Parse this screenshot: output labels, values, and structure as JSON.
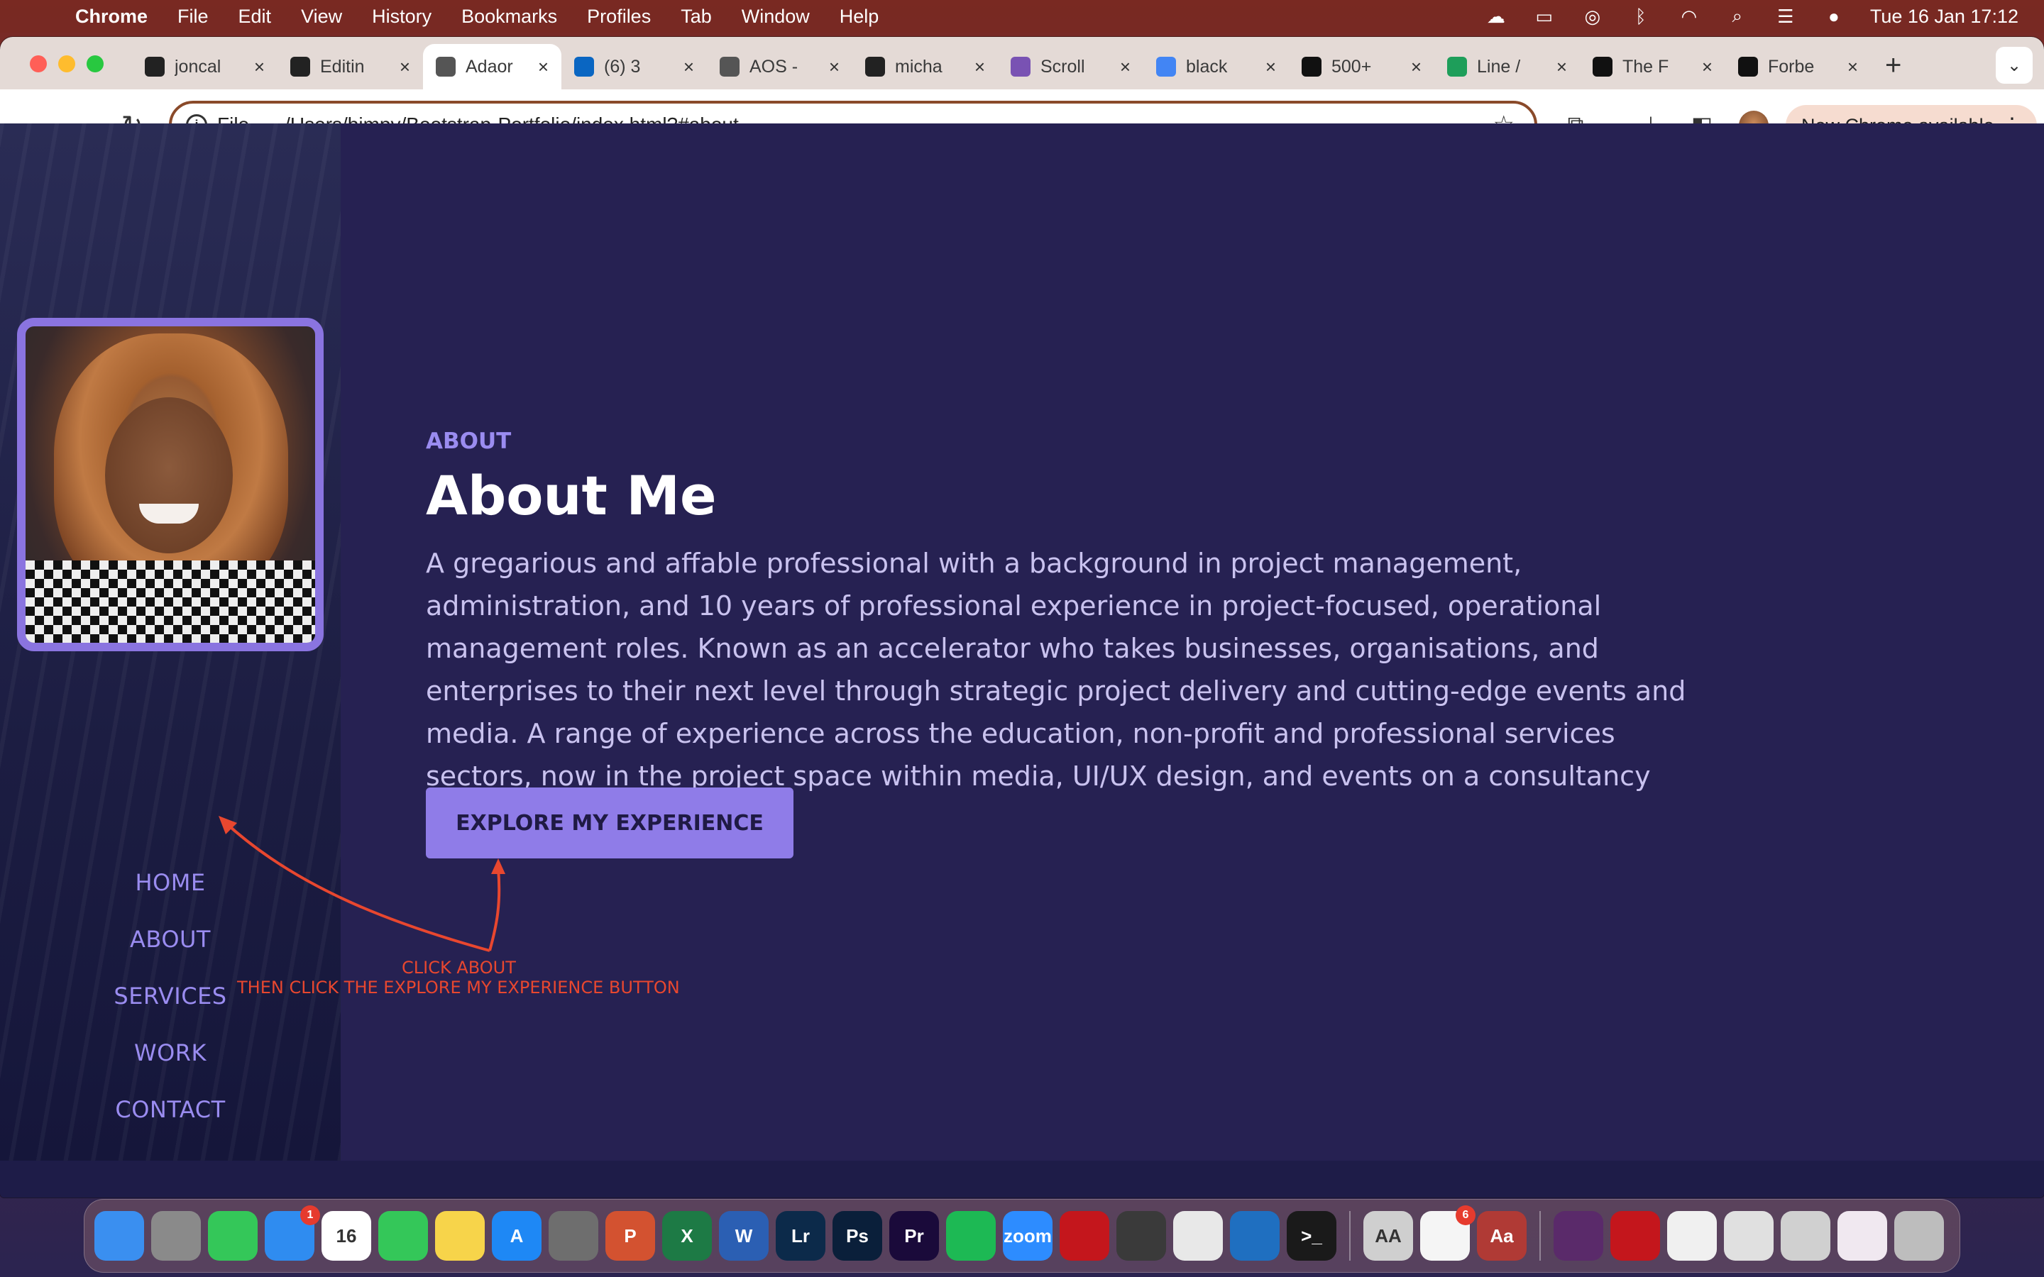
{
  "menubar": {
    "app_name": "Chrome",
    "items": [
      "File",
      "Edit",
      "View",
      "History",
      "Bookmarks",
      "Profiles",
      "Tab",
      "Window",
      "Help"
    ],
    "clock": "Tue 16 Jan  17:12"
  },
  "tabs": [
    {
      "title": "joncal",
      "icon": "github-icon",
      "color": "#222222"
    },
    {
      "title": "Editin",
      "icon": "github-icon",
      "color": "#222222"
    },
    {
      "title": "Adaor",
      "icon": "globe-icon",
      "color": "#555555",
      "active": true
    },
    {
      "title": "(6) 3",
      "icon": "linkedin-icon",
      "color": "#0a66c2"
    },
    {
      "title": "AOS -",
      "icon": "globe-icon",
      "color": "#555555"
    },
    {
      "title": "micha",
      "icon": "github-icon",
      "color": "#222222"
    },
    {
      "title": "Scroll",
      "icon": "bootstrap-icon",
      "color": "#7952b3"
    },
    {
      "title": "black",
      "icon": "google-icon",
      "color": "#4285f4"
    },
    {
      "title": "500+",
      "icon": "unsplash-icon",
      "color": "#111111"
    },
    {
      "title": "Line /",
      "icon": "sheets-icon",
      "color": "#1e9e5a"
    },
    {
      "title": "The F",
      "icon": "medium-icon",
      "color": "#111111"
    },
    {
      "title": "Forbe",
      "icon": "forbes-icon",
      "color": "#111111"
    }
  ],
  "toolbar": {
    "scheme_label": "File",
    "url": "/Users/bimpy/Bootstrap-Portfolio/index.html?#about",
    "update_label": "New Chrome available"
  },
  "nav": {
    "items": [
      "HOME",
      "ABOUT",
      "SERVICES",
      "WORK",
      "CONTACT"
    ]
  },
  "about": {
    "eyebrow": "ABOUT",
    "heading": "About Me",
    "bio": "A gregarious and affable professional with a background in project management, administration, and 10 years of professional experience in project-focused, operational management roles. Known as an accelerator who takes businesses, organisations, and enterprises to their next level through strategic project delivery and cutting-edge events and media. A range of experience across the education, non-profit and professional services sectors, now in the project space within media, UI/UX design, and events on a consultancy basis.",
    "cta_label": "EXPLORE MY EXPERIENCE"
  },
  "annotations": {
    "line1": "CLICK ABOUT",
    "line2": "THEN CLICK THE EXPLORE MY EXPERIENCE BUTTON",
    "color": "#e8472f"
  },
  "dock": {
    "items": [
      {
        "name": "finder-icon",
        "label": "",
        "color": "#3a8ff0"
      },
      {
        "name": "launchpad-icon",
        "label": "",
        "color": "#8a8a8a"
      },
      {
        "name": "messages-icon",
        "label": "",
        "color": "#34c759"
      },
      {
        "name": "mail-icon",
        "label": "",
        "color": "#2f8cf0",
        "badge": "1"
      },
      {
        "name": "calendar-icon",
        "label": "16",
        "color": "#ffffff"
      },
      {
        "name": "facetime-icon",
        "label": "",
        "color": "#34c759"
      },
      {
        "name": "notes-icon",
        "label": "",
        "color": "#f7d44a"
      },
      {
        "name": "app-store-icon",
        "label": "A",
        "color": "#1e88f5"
      },
      {
        "name": "system-settings-icon",
        "label": "",
        "color": "#6e6e6e"
      },
      {
        "name": "powerpoint-icon",
        "label": "P",
        "color": "#d35230"
      },
      {
        "name": "excel-icon",
        "label": "X",
        "color": "#1d7a45"
      },
      {
        "name": "word-icon",
        "label": "W",
        "color": "#2b5fb3"
      },
      {
        "name": "lightroom-icon",
        "label": "Lr",
        "color": "#0c2a4a"
      },
      {
        "name": "photoshop-icon",
        "label": "Ps",
        "color": "#0a1f3a"
      },
      {
        "name": "premiere-icon",
        "label": "Pr",
        "color": "#1a0a3a"
      },
      {
        "name": "spotify-icon",
        "label": "",
        "color": "#1db954"
      },
      {
        "name": "zoom-icon",
        "label": "zoom",
        "color": "#2d8cff"
      },
      {
        "name": "acrobat-icon",
        "label": "",
        "color": "#c4161c"
      },
      {
        "name": "calculator-icon",
        "label": "",
        "color": "#3a3a3a"
      },
      {
        "name": "chrome-icon",
        "label": "",
        "color": "#e8e8e8"
      },
      {
        "name": "vscode-icon",
        "label": "",
        "color": "#1f6fc0"
      },
      {
        "name": "terminal-icon",
        "label": ">_",
        "color": "#1a1a1a"
      },
      {
        "name": "font-book-icon",
        "label": "AA",
        "color": "#cfcfcf"
      },
      {
        "name": "reminders-icon",
        "label": "",
        "color": "#f5f5f5",
        "badge": "6"
      },
      {
        "name": "dictionary-icon",
        "label": "Aa",
        "color": "#b03a35"
      },
      {
        "name": "recent-image-icon",
        "label": "",
        "color": "#5a2a6a"
      },
      {
        "name": "recent-pdf-icon",
        "label": "",
        "color": "#c4161c"
      },
      {
        "name": "recent-doc-1-icon",
        "label": "",
        "color": "#f0f0f0"
      },
      {
        "name": "recent-doc-2-icon",
        "label": "",
        "color": "#e0e0e0"
      },
      {
        "name": "recent-doc-3-icon",
        "label": "",
        "color": "#d0d0d0"
      },
      {
        "name": "recent-doc-4-icon",
        "label": "",
        "color": "#f0e8f0"
      },
      {
        "name": "trash-icon",
        "label": "",
        "color": "#bdbdbd"
      }
    ]
  }
}
